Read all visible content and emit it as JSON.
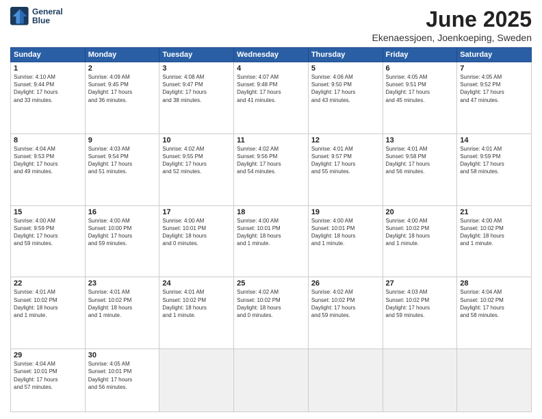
{
  "header": {
    "logo_line1": "General",
    "logo_line2": "Blue",
    "month": "June 2025",
    "location": "Ekenaessjoen, Joenkoeping, Sweden"
  },
  "weekdays": [
    "Sunday",
    "Monday",
    "Tuesday",
    "Wednesday",
    "Thursday",
    "Friday",
    "Saturday"
  ],
  "weeks": [
    [
      {
        "day": "1",
        "info": "Sunrise: 4:10 AM\nSunset: 9:44 PM\nDaylight: 17 hours\nand 33 minutes."
      },
      {
        "day": "2",
        "info": "Sunrise: 4:09 AM\nSunset: 9:45 PM\nDaylight: 17 hours\nand 36 minutes."
      },
      {
        "day": "3",
        "info": "Sunrise: 4:08 AM\nSunset: 9:47 PM\nDaylight: 17 hours\nand 38 minutes."
      },
      {
        "day": "4",
        "info": "Sunrise: 4:07 AM\nSunset: 9:48 PM\nDaylight: 17 hours\nand 41 minutes."
      },
      {
        "day": "5",
        "info": "Sunrise: 4:06 AM\nSunset: 9:50 PM\nDaylight: 17 hours\nand 43 minutes."
      },
      {
        "day": "6",
        "info": "Sunrise: 4:05 AM\nSunset: 9:51 PM\nDaylight: 17 hours\nand 45 minutes."
      },
      {
        "day": "7",
        "info": "Sunrise: 4:05 AM\nSunset: 9:52 PM\nDaylight: 17 hours\nand 47 minutes."
      }
    ],
    [
      {
        "day": "8",
        "info": "Sunrise: 4:04 AM\nSunset: 9:53 PM\nDaylight: 17 hours\nand 49 minutes."
      },
      {
        "day": "9",
        "info": "Sunrise: 4:03 AM\nSunset: 9:54 PM\nDaylight: 17 hours\nand 51 minutes."
      },
      {
        "day": "10",
        "info": "Sunrise: 4:02 AM\nSunset: 9:55 PM\nDaylight: 17 hours\nand 52 minutes."
      },
      {
        "day": "11",
        "info": "Sunrise: 4:02 AM\nSunset: 9:56 PM\nDaylight: 17 hours\nand 54 minutes."
      },
      {
        "day": "12",
        "info": "Sunrise: 4:01 AM\nSunset: 9:57 PM\nDaylight: 17 hours\nand 55 minutes."
      },
      {
        "day": "13",
        "info": "Sunrise: 4:01 AM\nSunset: 9:58 PM\nDaylight: 17 hours\nand 56 minutes."
      },
      {
        "day": "14",
        "info": "Sunrise: 4:01 AM\nSunset: 9:59 PM\nDaylight: 17 hours\nand 58 minutes."
      }
    ],
    [
      {
        "day": "15",
        "info": "Sunrise: 4:00 AM\nSunset: 9:59 PM\nDaylight: 17 hours\nand 59 minutes."
      },
      {
        "day": "16",
        "info": "Sunrise: 4:00 AM\nSunset: 10:00 PM\nDaylight: 17 hours\nand 59 minutes."
      },
      {
        "day": "17",
        "info": "Sunrise: 4:00 AM\nSunset: 10:01 PM\nDaylight: 18 hours\nand 0 minutes."
      },
      {
        "day": "18",
        "info": "Sunrise: 4:00 AM\nSunset: 10:01 PM\nDaylight: 18 hours\nand 1 minute."
      },
      {
        "day": "19",
        "info": "Sunrise: 4:00 AM\nSunset: 10:01 PM\nDaylight: 18 hours\nand 1 minute."
      },
      {
        "day": "20",
        "info": "Sunrise: 4:00 AM\nSunset: 10:02 PM\nDaylight: 18 hours\nand 1 minute."
      },
      {
        "day": "21",
        "info": "Sunrise: 4:00 AM\nSunset: 10:02 PM\nDaylight: 18 hours\nand 1 minute."
      }
    ],
    [
      {
        "day": "22",
        "info": "Sunrise: 4:01 AM\nSunset: 10:02 PM\nDaylight: 18 hours\nand 1 minute."
      },
      {
        "day": "23",
        "info": "Sunrise: 4:01 AM\nSunset: 10:02 PM\nDaylight: 18 hours\nand 1 minute."
      },
      {
        "day": "24",
        "info": "Sunrise: 4:01 AM\nSunset: 10:02 PM\nDaylight: 18 hours\nand 1 minute."
      },
      {
        "day": "25",
        "info": "Sunrise: 4:02 AM\nSunset: 10:02 PM\nDaylight: 18 hours\nand 0 minutes."
      },
      {
        "day": "26",
        "info": "Sunrise: 4:02 AM\nSunset: 10:02 PM\nDaylight: 17 hours\nand 59 minutes."
      },
      {
        "day": "27",
        "info": "Sunrise: 4:03 AM\nSunset: 10:02 PM\nDaylight: 17 hours\nand 59 minutes."
      },
      {
        "day": "28",
        "info": "Sunrise: 4:04 AM\nSunset: 10:02 PM\nDaylight: 17 hours\nand 58 minutes."
      }
    ],
    [
      {
        "day": "29",
        "info": "Sunrise: 4:04 AM\nSunset: 10:01 PM\nDaylight: 17 hours\nand 57 minutes."
      },
      {
        "day": "30",
        "info": "Sunrise: 4:05 AM\nSunset: 10:01 PM\nDaylight: 17 hours\nand 56 minutes."
      },
      {
        "day": "",
        "info": ""
      },
      {
        "day": "",
        "info": ""
      },
      {
        "day": "",
        "info": ""
      },
      {
        "day": "",
        "info": ""
      },
      {
        "day": "",
        "info": ""
      }
    ]
  ]
}
